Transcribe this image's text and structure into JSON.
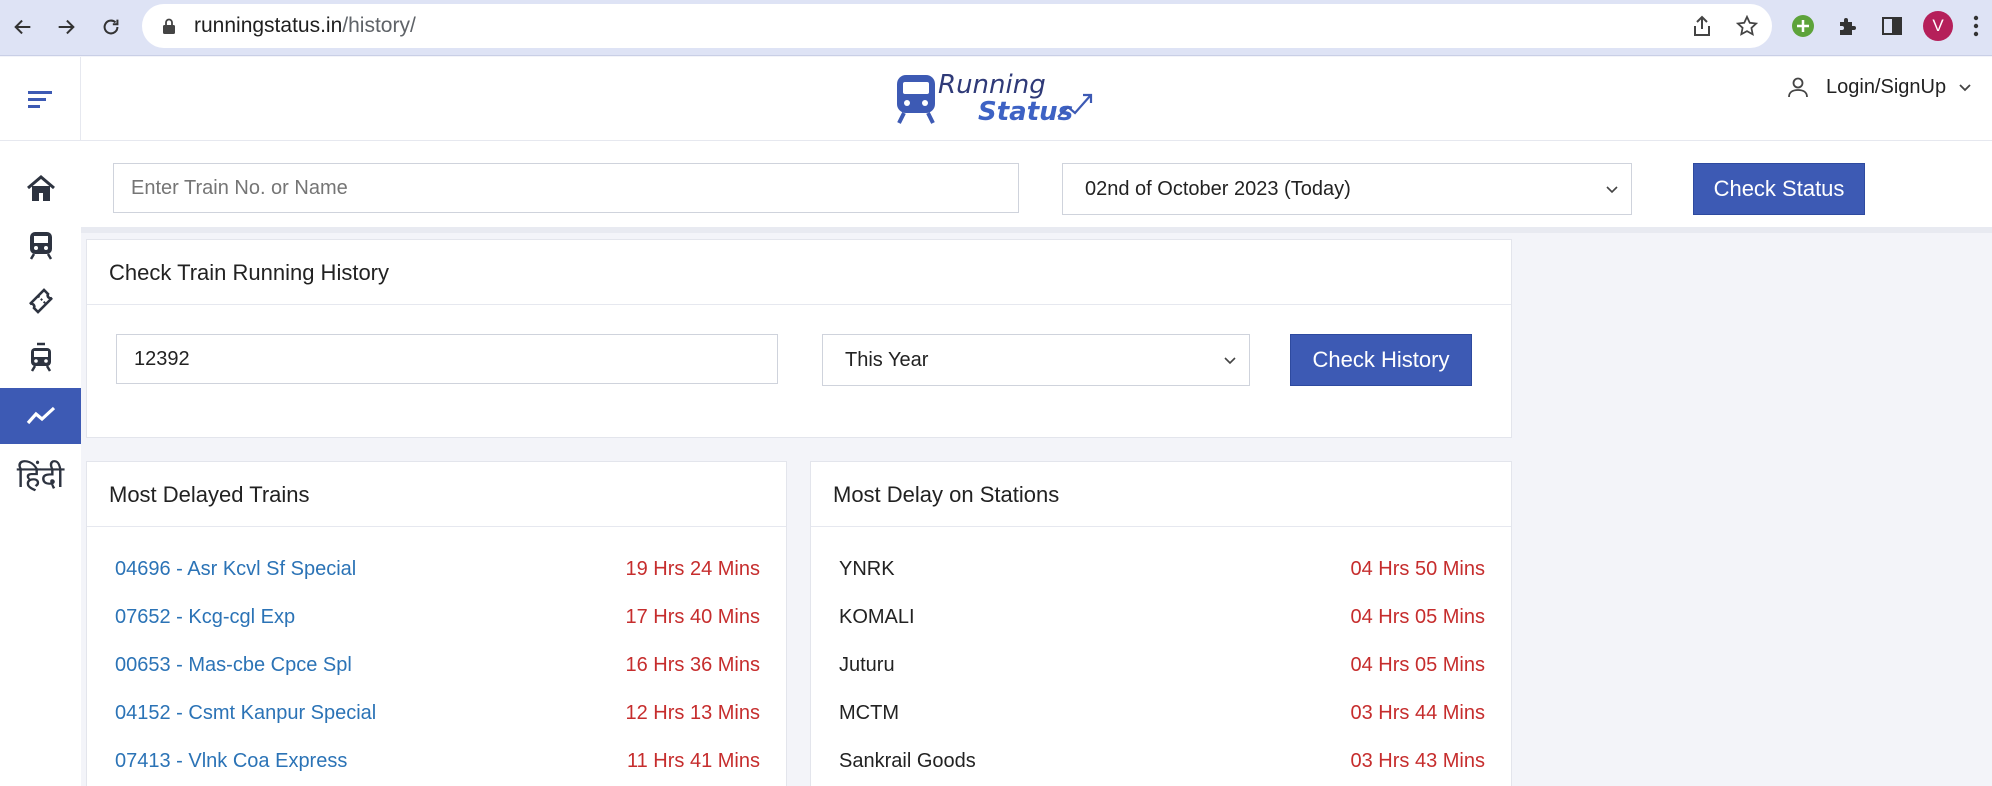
{
  "browser": {
    "url_host": "runningstatus.in",
    "url_path": "/history/",
    "profile_initial": "V"
  },
  "header": {
    "logo_line1": "Running",
    "logo_line2": "Status",
    "login_label": "Login/SignUp"
  },
  "sidebar": {
    "items": [
      {
        "icon": "home-icon"
      },
      {
        "icon": "train-icon"
      },
      {
        "icon": "ticket-icon"
      },
      {
        "icon": "metro-icon"
      },
      {
        "icon": "trend-icon",
        "active": true
      },
      {
        "label": "हिंदी"
      }
    ]
  },
  "search": {
    "train_placeholder": "Enter Train No. or Name",
    "date_selected": "02nd of October 2023 (Today)",
    "check_status_label": "Check Status"
  },
  "history": {
    "title": "Check Train Running History",
    "train_value": "12392",
    "period_selected": "This Year",
    "check_history_label": "Check History"
  },
  "most_delayed_trains": {
    "title": "Most Delayed Trains",
    "rows": [
      {
        "name": "04696 - Asr Kcvl Sf Special",
        "delay": "19 Hrs 24 Mins"
      },
      {
        "name": "07652 - Kcg-cgl Exp",
        "delay": "17 Hrs 40 Mins"
      },
      {
        "name": "00653 - Mas-cbe Cpce Spl",
        "delay": "16 Hrs 36 Mins"
      },
      {
        "name": "04152 - Csmt Kanpur Special",
        "delay": "12 Hrs 13 Mins"
      },
      {
        "name": "07413 - Vlnk Coa Express",
        "delay": "11 Hrs 41 Mins"
      }
    ]
  },
  "most_delay_stations": {
    "title": "Most Delay on Stations",
    "rows": [
      {
        "name": "YNRK",
        "delay": "04 Hrs 50 Mins"
      },
      {
        "name": "KOMALI",
        "delay": "04 Hrs 05 Mins"
      },
      {
        "name": "Juturu",
        "delay": "04 Hrs 05 Mins"
      },
      {
        "name": "MCTM",
        "delay": "03 Hrs 44 Mins"
      },
      {
        "name": "Sankrail Goods",
        "delay": "03 Hrs 43 Mins"
      }
    ]
  },
  "colors": {
    "accent": "#3d5ab4",
    "link": "#2b73b6",
    "delay": "#c62d2d"
  }
}
